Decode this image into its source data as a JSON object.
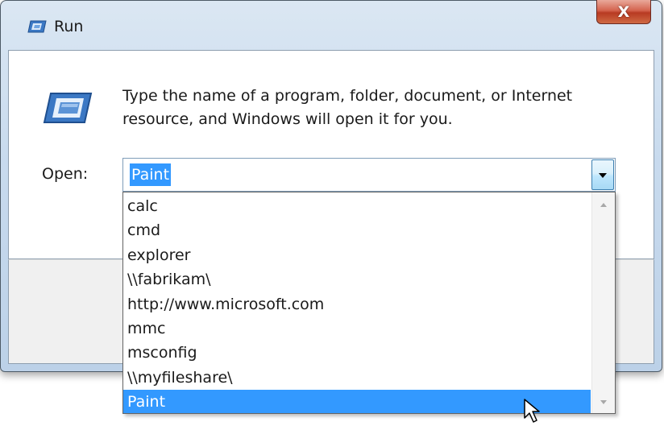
{
  "window": {
    "title": "Run",
    "close_label": "X",
    "title_icon": "run-icon",
    "colors": {
      "selection": "#3399ff",
      "close": "#c9452c"
    }
  },
  "dialog": {
    "description": "Type the name of a program, folder, document, or Internet resource, and Windows will open it for you.",
    "open_label": "Open:",
    "open_value": "Paint"
  },
  "dropdown": {
    "items": [
      "calc",
      "cmd",
      "explorer",
      "\\\\fabrikam\\",
      "http://www.microsoft.com",
      "mmc",
      "msconfig",
      "\\\\myfileshare\\",
      "Paint"
    ],
    "selected_index": 8
  }
}
